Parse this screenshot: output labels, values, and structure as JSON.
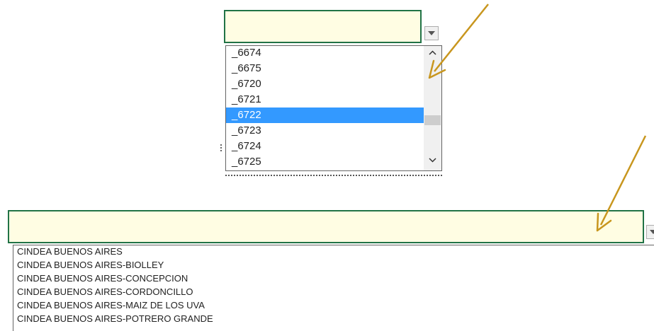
{
  "top_dropdown": {
    "cell_value": "",
    "options": [
      "_6674",
      "_6675",
      "_6720",
      "_6721",
      "_6722",
      "_6723",
      "_6724",
      "_6725"
    ],
    "selected": "_6722",
    "scroll_position": 0.66
  },
  "bottom_dropdown": {
    "cell_value": "",
    "options": [
      "CINDEA BUENOS AIRES",
      "CINDEA BUENOS AIRES-BIOLLEY",
      "CINDEA BUENOS AIRES-CONCEPCION",
      "CINDEA BUENOS AIRES-CORDONCILLO",
      "CINDEA BUENOS AIRES-MAIZ DE LOS UVA",
      "CINDEA BUENOS AIRES-POTRERO GRANDE"
    ]
  },
  "annotations": {
    "arrow_color": "#c8961e",
    "count": 2
  },
  "colors": {
    "cell_fill": "#fffde3",
    "cell_border": "#217346",
    "selection": "#3399ff"
  },
  "icons": {
    "dropdown": "chevron-down-icon",
    "scroll_up": "chevron-up-icon",
    "scroll_down": "chevron-down-icon",
    "annotation": "arrow-icon"
  }
}
